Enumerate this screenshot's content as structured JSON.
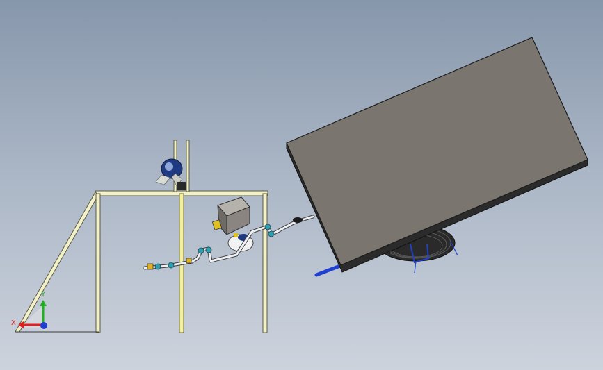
{
  "viewport": {
    "background_top": "#8797ab",
    "background_bottom": "#cdd3dd"
  },
  "triad": {
    "x_label": "X",
    "y_label": "Y",
    "x_color": "#e02020",
    "y_color": "#22b022",
    "z_color": "#1f3fd0"
  },
  "colors": {
    "frame": "#f3f1c8",
    "frame_edge": "#5a5a45",
    "panel_face": "#7a756f",
    "panel_side": "#2b2b2b",
    "pipe": "#eef0f3",
    "fitting": "#2f9fb0",
    "motor": "#1f3a80",
    "box": "#8a8580"
  }
}
